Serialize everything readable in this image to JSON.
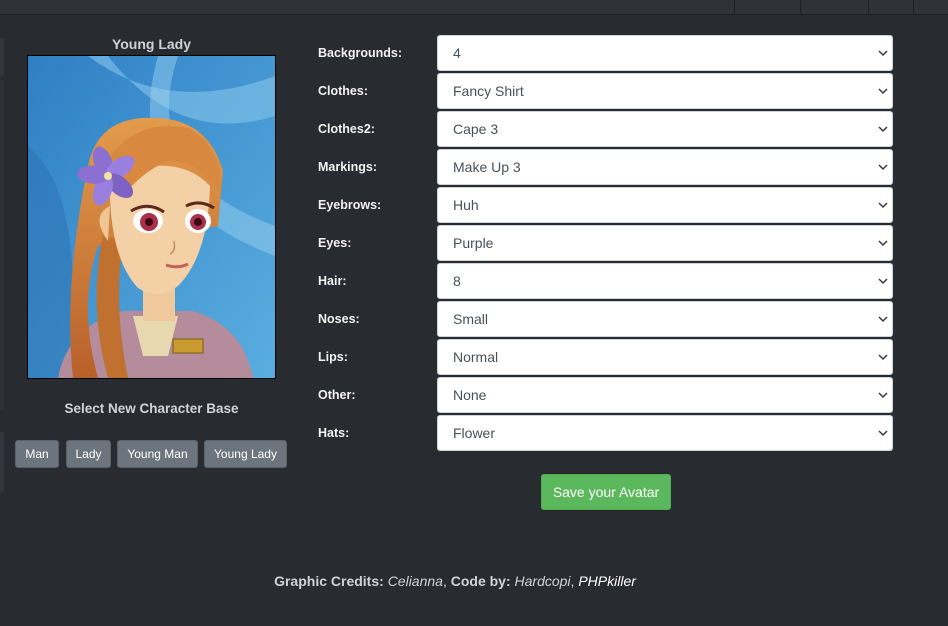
{
  "character": {
    "title": "Young Lady",
    "select_label": "Select New Character Base",
    "bases": [
      "Man",
      "Lady",
      "Young Man",
      "Young Lady"
    ]
  },
  "options": [
    {
      "label": "Backgrounds:",
      "value": "4"
    },
    {
      "label": "Clothes:",
      "value": "Fancy Shirt"
    },
    {
      "label": "Clothes2:",
      "value": "Cape 3"
    },
    {
      "label": "Markings:",
      "value": "Make Up 3"
    },
    {
      "label": "Eyebrows:",
      "value": "Huh"
    },
    {
      "label": "Eyes:",
      "value": "Purple"
    },
    {
      "label": "Hair:",
      "value": "8"
    },
    {
      "label": "Noses:",
      "value": "Small"
    },
    {
      "label": "Lips:",
      "value": "Normal"
    },
    {
      "label": "Other:",
      "value": "None"
    },
    {
      "label": "Hats:",
      "value": "Flower"
    }
  ],
  "save_label": "Save your Avatar",
  "credits": {
    "graphic_label": "Graphic Credits:",
    "graphic_name": "Celianna",
    "code_label": "Code by:",
    "code_name1": "Hardcopi",
    "code_name2": "PHPkiller"
  },
  "icons": {
    "select_arrow": "chevron-down-icon",
    "hat": "flower-icon"
  },
  "colors": {
    "background": "#282b30",
    "button_gray": "#6c757d",
    "save_green": "#5cb85c"
  }
}
